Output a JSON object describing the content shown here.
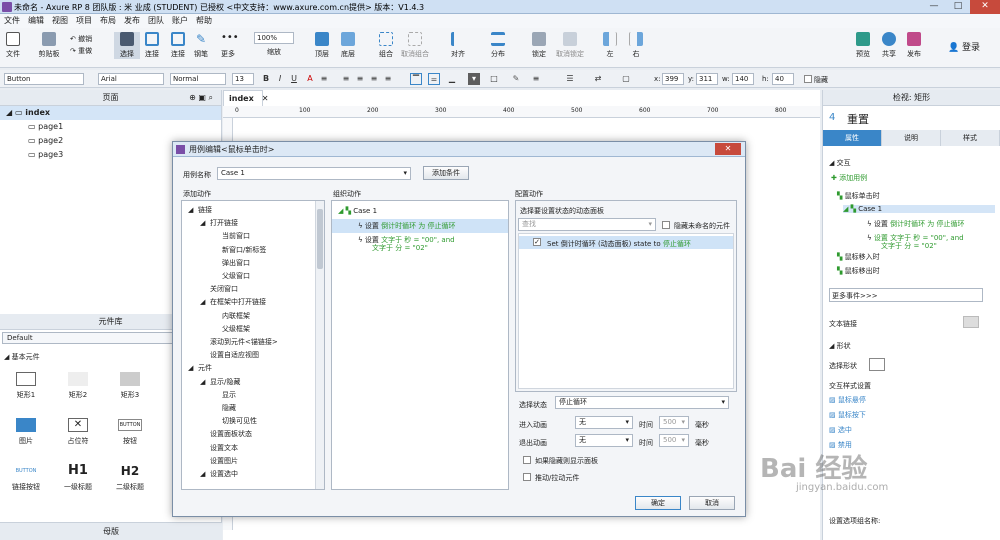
{
  "window": {
    "title": "未命名 - Axure RP 8 团队版 : 米 业成 (STUDENT) 已授权    <中文支持：www.axure.com.cn提供> 版本：V1.4.3",
    "min": "—",
    "max": "□",
    "close": "✕"
  },
  "menu": [
    "文件",
    "编辑",
    "视图",
    "项目",
    "布局",
    "发布",
    "团队",
    "账户",
    "帮助"
  ],
  "toolbar": {
    "file": "文件",
    "clipboard": "剪贴板",
    "undo": "撤销",
    "redo": "重做",
    "select": "选择",
    "connect": "连接",
    "pen": "钢笔",
    "more": "更多",
    "zoom_value": "100%",
    "zoom": "缩放",
    "top": "顶层",
    "bottom": "底层",
    "group": "组合",
    "ungroup": "取消组合",
    "align": "对齐",
    "distribute": "分布",
    "lock": "锁定",
    "unlock": "取消锁定",
    "left": "左",
    "right": "右",
    "preview": "预览",
    "share": "共享",
    "publish": "发布",
    "login": "登录"
  },
  "format": {
    "widget_type": "Button",
    "font": "Arial",
    "style": "Normal",
    "size": "13",
    "x_label": "x:",
    "x": "399",
    "y_label": "y:",
    "y": "311",
    "w_label": "w:",
    "w": "140",
    "h_label": "h:",
    "h": "40",
    "hidden": "隐藏"
  },
  "pages": {
    "title": "页面",
    "items": [
      "index",
      "page1",
      "page2",
      "page3"
    ]
  },
  "library": {
    "title": "元件库",
    "selected": "Default",
    "section": "基本元件",
    "widgets": [
      "矩形1",
      "矩形2",
      "矩形3",
      "图片",
      "占位符",
      "按钮",
      "链接按钮",
      "一级标题",
      "二级标题"
    ],
    "widget_glyphs": [
      "",
      "",
      "",
      "",
      "",
      "BUTTON",
      "BUTTON",
      "H1",
      "H2"
    ]
  },
  "masters": {
    "title": "母版"
  },
  "canvas": {
    "tab": "index",
    "ruler_ticks": [
      "0",
      "100",
      "200",
      "300",
      "400",
      "500",
      "600",
      "700",
      "800"
    ]
  },
  "inspector": {
    "title": "检视: 矩形",
    "count": "4",
    "name": "重置",
    "tabs": [
      "属性",
      "说明",
      "样式"
    ],
    "interaction": "交互",
    "add_case": "添加用例",
    "event_click": "鼠标单击时",
    "case": "Case 1",
    "action1": "设置 倒计时循环 为 停止循环",
    "action2a": "设置 文字于 秒 = \"00\", and",
    "action2b": "文字于 分 = \"02\"",
    "event_enter": "鼠标移入时",
    "event_leave": "鼠标移出时",
    "more_events": "更多事件>>>",
    "text_link": "文本链接",
    "shape": "形状",
    "select_shape": "选择形状",
    "interaction_styles": "交互样式设置",
    "hover": "鼠标悬停",
    "mouse_down": "鼠标按下",
    "selected": "选中",
    "disabled": "禁用",
    "option_group": "设置选项组名称:"
  },
  "dialog": {
    "title": "用例编辑<鼠标单击时>",
    "case_name_label": "用例名称",
    "case_name": "Case 1",
    "add_condition": "添加条件",
    "col1": "添加动作",
    "col2": "组织动作",
    "col3": "配置动作",
    "actions": [
      {
        "t": "链接",
        "lvl": 0,
        "exp": "▲"
      },
      {
        "t": "打开链接",
        "lvl": 1,
        "exp": "▲"
      },
      {
        "t": "当前窗口",
        "lvl": 2,
        "exp": ""
      },
      {
        "t": "新窗口/新标签",
        "lvl": 2,
        "exp": ""
      },
      {
        "t": "弹出窗口",
        "lvl": 2,
        "exp": ""
      },
      {
        "t": "父级窗口",
        "lvl": 2,
        "exp": ""
      },
      {
        "t": "关闭窗口",
        "lvl": 1,
        "exp": ""
      },
      {
        "t": "在框架中打开链接",
        "lvl": 1,
        "exp": "▲"
      },
      {
        "t": "内联框架",
        "lvl": 2,
        "exp": ""
      },
      {
        "t": "父级框架",
        "lvl": 2,
        "exp": ""
      },
      {
        "t": "滚动到元件<锚链接>",
        "lvl": 1,
        "exp": ""
      },
      {
        "t": "设置自适应视图",
        "lvl": 1,
        "exp": ""
      },
      {
        "t": "元件",
        "lvl": 0,
        "exp": "▲"
      },
      {
        "t": "显示/隐藏",
        "lvl": 1,
        "exp": "▲"
      },
      {
        "t": "显示",
        "lvl": 2,
        "exp": ""
      },
      {
        "t": "隐藏",
        "lvl": 2,
        "exp": ""
      },
      {
        "t": "切换可见性",
        "lvl": 2,
        "exp": ""
      },
      {
        "t": "设置面板状态",
        "lvl": 1,
        "exp": ""
      },
      {
        "t": "设置文本",
        "lvl": 1,
        "exp": ""
      },
      {
        "t": "设置图片",
        "lvl": 1,
        "exp": ""
      },
      {
        "t": "设置选中",
        "lvl": 1,
        "exp": "▲"
      }
    ],
    "org_case": "Case 1",
    "org_action1_prefix": "设置",
    "org_action1": "倒计时循环 为 停止循环",
    "org_action2_prefix": "设置",
    "org_action2a": "文字于 秒 = \"00\", and",
    "org_action2b": "文字于 分 = \"02\"",
    "config_title": "选择要设置状态的动态面板",
    "search_placeholder": "查找",
    "hide_unnamed": "隐藏未命名的元件",
    "panel_item": "Set 倒计时循环 (动态面板) state to",
    "panel_item_state": "停止循环",
    "select_state_label": "选择状态",
    "select_state": "停止循环",
    "enter_anim_label": "进入动画",
    "enter_anim": "无",
    "exit_anim_label": "退出动画",
    "exit_anim": "无",
    "time_label": "时间",
    "time": "500",
    "ms": "毫秒",
    "show_if_hidden": "如果隐藏则显示面板",
    "push_pull": "推动/拉动元件",
    "ok": "确定",
    "cancel": "取消"
  },
  "watermark": {
    "text": "Bai 经验",
    "url": "jingyan.baidu.com"
  },
  "colors": {
    "accent": "#3a86c8",
    "green": "#2e9a2e",
    "close": "#c74a3c"
  }
}
